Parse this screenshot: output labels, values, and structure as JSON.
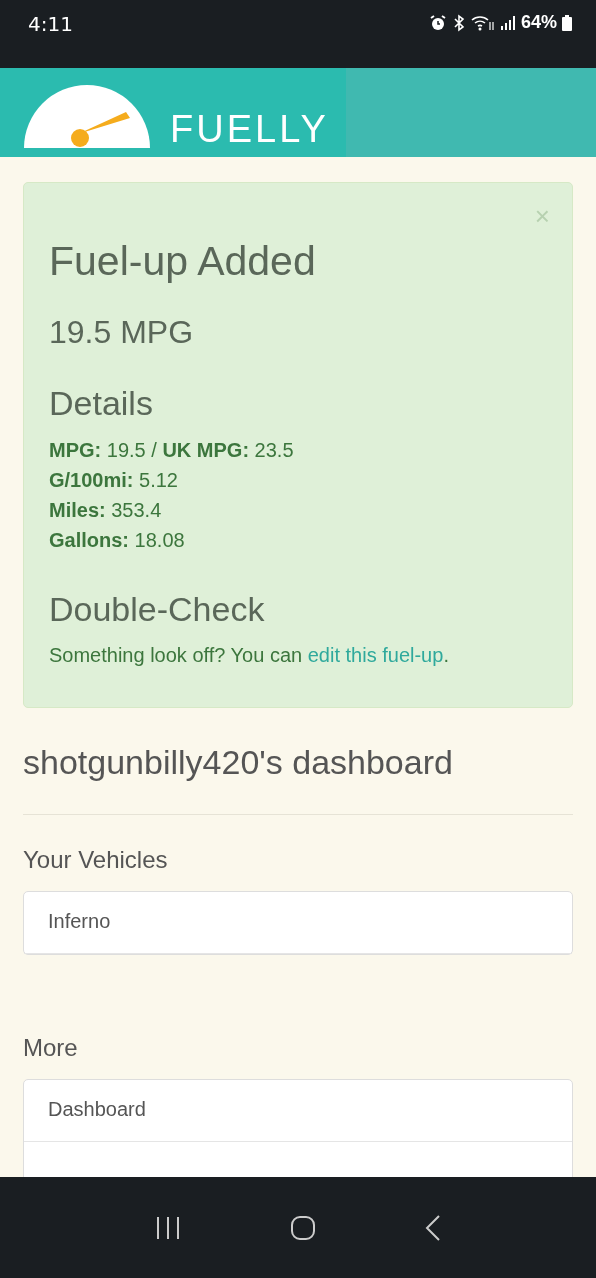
{
  "status_bar": {
    "time": "4:11",
    "battery": "64%"
  },
  "header": {
    "logo": "FUELLY"
  },
  "alert": {
    "close": "×",
    "title": "Fuel-up Added",
    "mpg": "19.5 MPG",
    "details_heading": "Details",
    "stats": [
      "**MPG:** 19.5 / **UK MPG:** 23.5",
      "**G/100mi:** 5.12",
      "**Miles:** 353.4",
      "**Gallons:** 18.08"
    ],
    "check_heading": "Double-Check",
    "check_text": "Something look off? You can ",
    "check_link": "edit this fuel-up",
    "check_end": "."
  },
  "dashboard_title": "shotgunbilly420's dashboard",
  "vehicles": {
    "heading": "Your Vehicles",
    "items": [
      "Inferno"
    ]
  },
  "more": {
    "heading": "More",
    "items": [
      "Dashboard"
    ]
  }
}
